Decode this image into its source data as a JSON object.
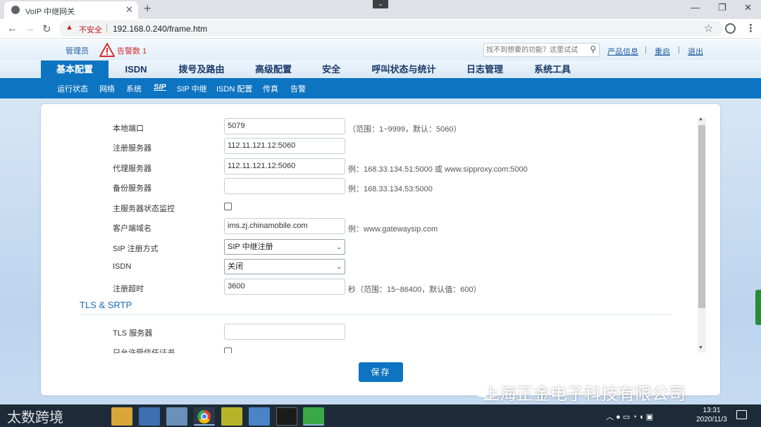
{
  "browser": {
    "tab_title": "VoIP 中继网关",
    "insecure_label": "不安全",
    "url": "192.168.0.240/frame.htm"
  },
  "gateway_header": {
    "admin": "管理员",
    "alarm_label": "告警数",
    "alarm_count": "1",
    "search_placeholder": "找不到想要的功能？这里试试",
    "links": [
      "产品信息",
      "重启",
      "退出"
    ]
  },
  "main_nav": [
    "基本配置",
    "ISDN",
    "拨号及路由",
    "高级配置",
    "安全",
    "呼叫状态与统计",
    "日志管理",
    "系统工具"
  ],
  "main_nav_active": "基本配置",
  "sub_nav": [
    "运行状态",
    "网络",
    "系统",
    "SIP",
    "SIP 中继",
    "ISDN 配置",
    "传真",
    "告警"
  ],
  "sub_nav_active": "SIP",
  "form": {
    "local_port_label": "本地端口",
    "local_port_value": "5079",
    "local_port_hint": "（范围：1~9999，默认：5060）",
    "reg_server_label": "注册服务器",
    "reg_server_value": "112.11.121.12:5060",
    "proxy_server_label": "代理服务器",
    "proxy_server_value": "112.11.121.12:5060",
    "proxy_server_hint": "例：168.33.134.51:5000 或 www.sipproxy.com:5000",
    "backup_server_label": "备份服务器",
    "backup_server_value": "",
    "backup_server_hint": "例：168.33.134.53:5000",
    "monitor_label": "主服务器状态监控",
    "client_domain_label": "客户端域名",
    "client_domain_value": "ims.zj.chinamobile.com",
    "client_domain_hint": "例：www.gatewaysip.com",
    "reg_mode_label": "SIP 注册方式",
    "reg_mode_value": "SIP 中继注册",
    "isdn_label": "ISDN",
    "isdn_value": "关闭",
    "reg_timeout_label": "注册超时",
    "reg_timeout_value": "3600",
    "reg_timeout_hint": "秒（范围：15~86400，默认值：600）",
    "tls_section": "TLS & SRTP",
    "tls_server_label": "TLS 服务器",
    "tls_server_value": "",
    "trusted_cert_label": "只允许受信任证书"
  },
  "save_label": "保存",
  "watermark": "上海正金电子科技有限公司",
  "watermark_left": "太数跨境",
  "clock": {
    "time": "13:31",
    "date": "2020/11/3"
  },
  "colors": {
    "accent": "#0d74c1",
    "alarm": "#d32f2f"
  }
}
